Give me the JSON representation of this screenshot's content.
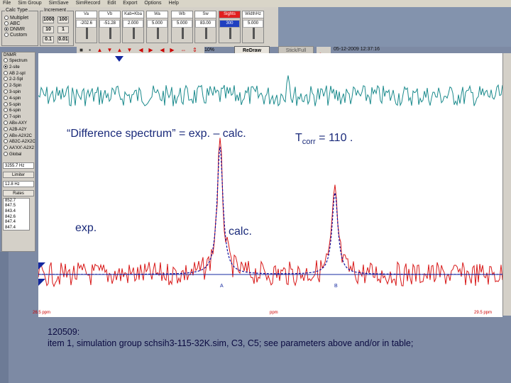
{
  "menubar": {
    "items": [
      "File",
      "Sim Group",
      "SimSave",
      "SimRecord",
      "Edit",
      "Export",
      "Options",
      "Help"
    ]
  },
  "calc_type": {
    "title": "Calc Type",
    "options": [
      "Multiplet",
      "ABC",
      "DNMR",
      "Custom"
    ],
    "selected": "DNMR"
  },
  "increment": {
    "title": "Increment",
    "values": [
      "1000",
      "100",
      "10",
      "1",
      "0.1",
      "0.01"
    ]
  },
  "params": [
    {
      "label": "Va",
      "value": "-202.6"
    },
    {
      "label": "Vb",
      "value": "-51.28"
    },
    {
      "label": "Kab=Kba",
      "value": "2.000"
    },
    {
      "label": "Wa",
      "value": "5.000"
    },
    {
      "label": "Wb",
      "value": "5.000"
    },
    {
      "label": "Sw",
      "value": "83.00"
    },
    {
      "label": "Sights",
      "value": "300"
    },
    {
      "label": "WidthHz",
      "value": "5.000"
    }
  ],
  "toolbar": {
    "zoom": "10%",
    "redraw": "ReDraw",
    "stick": "Stick/Full",
    "timestamp": "05-12-2009  12:37:16"
  },
  "dnmr": {
    "title": "DNMR",
    "options": [
      "Spectrum",
      "2-site",
      "AB 2-spl",
      "2-2-Spl",
      "2-Spin",
      "3-spin",
      "4-spin",
      "5-spin",
      "6-spin",
      "7-spin",
      "ABx-AXY",
      "A2B-A2Y",
      "ABx-A2X2C",
      "AB2C-A2X2C",
      "AA'XX'-A2X2",
      "Global"
    ],
    "selected": "2-site",
    "freq": "3255.7 Hz",
    "limiter_label": "Limiter",
    "width": "12.8 Hz",
    "rates_label": "Rates",
    "list": [
      "852.7",
      "847.5",
      "843.4",
      "842.6",
      "847.4",
      "847.4"
    ]
  },
  "spectrum_labels": {
    "difference": "“Difference spectrum” = exp. – calc.",
    "tcorr_T": "T",
    "tcorr_sub": "corr",
    "tcorr_val": " = 110 .",
    "exp": "exp.",
    "calc": "calc.",
    "peak_a": "A",
    "peak_b": "B",
    "axis_left": "26.5 ppm",
    "axis_mid": "ppm",
    "axis_right": "29.5 ppm"
  },
  "caption": {
    "line1": "120509:",
    "line2": "item 1, simulation group schsih3-115-32K.sim,  C3, C5; see parameters above and/or in table;"
  },
  "colors": {
    "difference_trace": "#1a8a8c",
    "exp_trace": "#d81818",
    "calc_trace": "#1010a0",
    "peak_marker": "#1428a0"
  }
}
